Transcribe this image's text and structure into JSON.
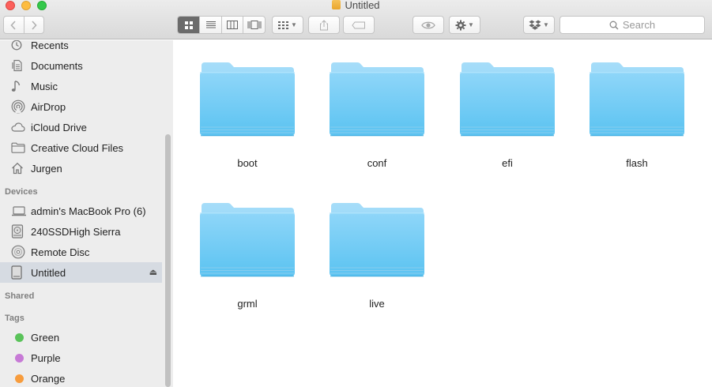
{
  "window": {
    "title": "Untitled"
  },
  "toolbar": {
    "back_icon": "chevron-left-icon",
    "forward_icon": "chevron-right-icon",
    "views": [
      "icon-view-icon",
      "list-view-icon",
      "column-view-icon",
      "gallery-view-icon"
    ],
    "active_view": "icon-view-icon",
    "search_placeholder": "Search"
  },
  "sidebar": {
    "favorites": [
      {
        "label": "Recents",
        "icon": "clock-icon"
      },
      {
        "label": "Documents",
        "icon": "document-icon"
      },
      {
        "label": "Music",
        "icon": "music-note-icon"
      },
      {
        "label": "AirDrop",
        "icon": "airdrop-icon"
      },
      {
        "label": "iCloud Drive",
        "icon": "cloud-icon"
      },
      {
        "label": "Creative Cloud Files",
        "icon": "folder-icon"
      },
      {
        "label": "Jurgen",
        "icon": "home-icon"
      }
    ],
    "devices_heading": "Devices",
    "devices": [
      {
        "label": "admin's MacBook Pro (6)",
        "icon": "laptop-icon"
      },
      {
        "label": "240SSDHigh Sierra",
        "icon": "hard-drive-icon"
      },
      {
        "label": "Remote Disc",
        "icon": "disc-icon"
      },
      {
        "label": "Untitled",
        "icon": "drive-icon",
        "selected": true
      }
    ],
    "shared_heading": "Shared",
    "tags_heading": "Tags",
    "tags": [
      {
        "label": "Green",
        "color": "#5ac35a"
      },
      {
        "label": "Purple",
        "color": "#c77ad6"
      },
      {
        "label": "Orange",
        "color": "#f79c3d"
      }
    ]
  },
  "content": {
    "folders": [
      {
        "name": "boot"
      },
      {
        "name": "conf"
      },
      {
        "name": "efi"
      },
      {
        "name": "flash"
      },
      {
        "name": "grml"
      },
      {
        "name": "live"
      }
    ]
  },
  "colors": {
    "folder_light": "#8fd6f9",
    "folder_dark": "#5bc3f1",
    "selection": "#d6dbe2"
  }
}
